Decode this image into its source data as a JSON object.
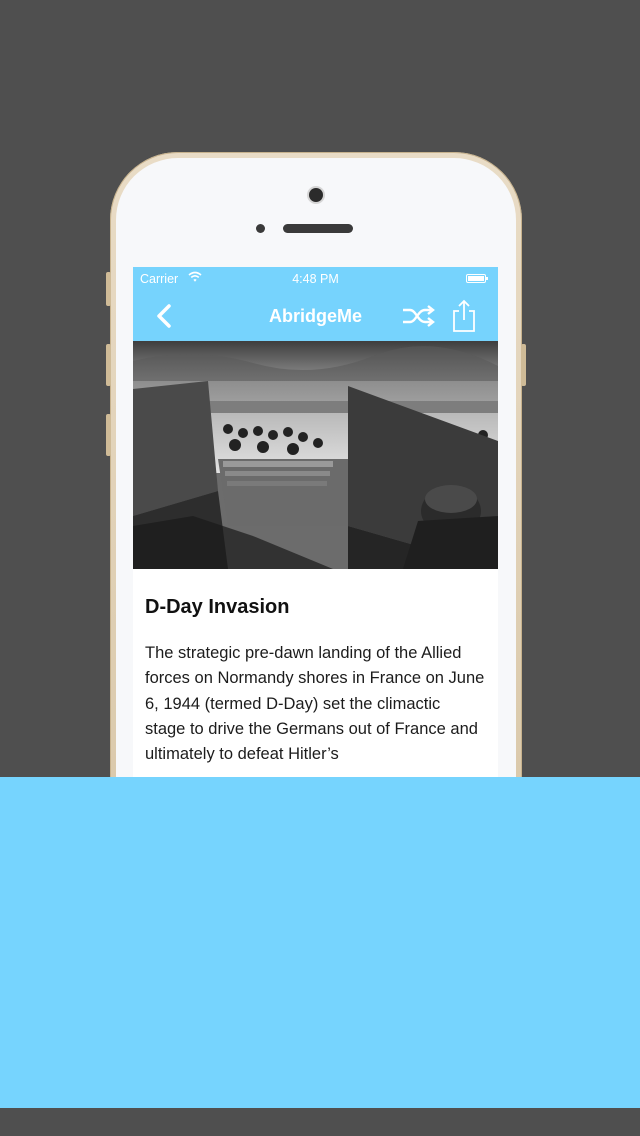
{
  "status_bar": {
    "carrier": "Carrier",
    "time": "4:48 PM",
    "wifi_icon": "wifi-icon",
    "battery_icon": "battery-icon"
  },
  "nav_bar": {
    "title": "AbridgeMe",
    "back_icon": "chevron-left-icon",
    "shuffle_icon": "shuffle-icon",
    "share_icon": "share-icon"
  },
  "article": {
    "image": "black-and-white photo of soldiers in a landing craft approaching a beach",
    "title": "D-Day Invasion",
    "body": "The strategic pre-dawn landing of the Allied forces on Normandy shores in France on June 6, 1944 (termed D-Day) set the climactic stage to drive the Germans out of France and ultimately to defeat Hitler’s"
  },
  "colors": {
    "accent": "#76d3fd",
    "background": "#4f4f4f",
    "phone_frame": "#e4d5bb"
  }
}
